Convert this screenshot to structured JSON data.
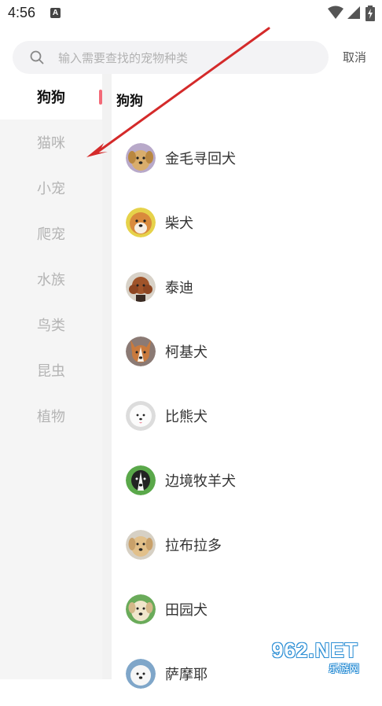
{
  "status_bar": {
    "time": "4:56",
    "notification_badge": "A"
  },
  "search": {
    "placeholder": "输入需要查找的宠物种类",
    "value": "",
    "cancel_label": "取消"
  },
  "sidebar": {
    "items": [
      {
        "label": "狗狗",
        "active": true
      },
      {
        "label": "猫咪",
        "active": false
      },
      {
        "label": "小宠",
        "active": false
      },
      {
        "label": "爬宠",
        "active": false
      },
      {
        "label": "水族",
        "active": false
      },
      {
        "label": "鸟类",
        "active": false
      },
      {
        "label": "昆虫",
        "active": false
      },
      {
        "label": "植物",
        "active": false
      }
    ]
  },
  "content": {
    "section_title": "狗狗",
    "pets": [
      {
        "name": "金毛寻回犬",
        "avatar": "golden-retriever-icon",
        "color": "#c99a5b"
      },
      {
        "name": "柴犬",
        "avatar": "shiba-icon",
        "color": "#d98a3c"
      },
      {
        "name": "泰迪",
        "avatar": "poodle-icon",
        "color": "#a0542a"
      },
      {
        "name": "柯基犬",
        "avatar": "corgi-icon",
        "color": "#c97a3d"
      },
      {
        "name": "比熊犬",
        "avatar": "bichon-icon",
        "color": "#eeeeee"
      },
      {
        "name": "边境牧羊犬",
        "avatar": "border-collie-icon",
        "color": "#2b2b2b"
      },
      {
        "name": "拉布拉多",
        "avatar": "labrador-icon",
        "color": "#e2c08a"
      },
      {
        "name": "田园犬",
        "avatar": "rural-dog-icon",
        "color": "#e8dcc0"
      },
      {
        "name": "萨摩耶",
        "avatar": "samoyed-icon",
        "color": "#f2f2f2"
      }
    ]
  },
  "watermark": {
    "main": "962.NET",
    "sub": "乐游网"
  },
  "colors": {
    "accent": "#f36a78",
    "arrow": "#d42a2a",
    "watermark_blue": "#2d8fd5"
  }
}
